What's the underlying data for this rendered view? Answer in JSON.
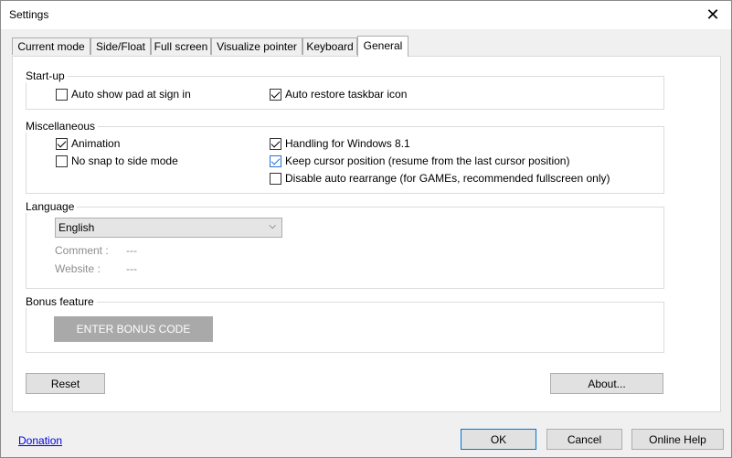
{
  "window": {
    "title": "Settings"
  },
  "tabs": [
    {
      "label": "Current mode"
    },
    {
      "label": "Side/Float"
    },
    {
      "label": "Full screen"
    },
    {
      "label": "Visualize pointer"
    },
    {
      "label": "Keyboard"
    },
    {
      "label": "General",
      "active": true
    }
  ],
  "startup": {
    "legend": "Start-up",
    "auto_show_pad": {
      "label": "Auto show pad at sign in",
      "checked": false
    },
    "auto_restore_taskbar": {
      "label": "Auto restore taskbar icon",
      "checked": true
    }
  },
  "misc": {
    "legend": "Miscellaneous",
    "animation": {
      "label": "Animation",
      "checked": true
    },
    "no_snap": {
      "label": "No snap to side mode",
      "checked": false
    },
    "handling_win81": {
      "label": "Handling for Windows 8.1",
      "checked": true
    },
    "keep_cursor": {
      "label": "Keep cursor position (resume from the last cursor position)",
      "checked": true
    },
    "disable_rearrange": {
      "label": "Disable auto rearrange (for GAMEs, recommended fullscreen only)",
      "checked": false
    }
  },
  "language": {
    "legend": "Language",
    "selected": "English",
    "comment_label": "Comment :",
    "comment_value": "---",
    "website_label": "Website :",
    "website_value": "---"
  },
  "bonus": {
    "legend": "Bonus feature",
    "button_label": "ENTER BONUS CODE"
  },
  "panel_buttons": {
    "reset": "Reset",
    "about": "About..."
  },
  "footer": {
    "donation": "Donation",
    "ok": "OK",
    "cancel": "Cancel",
    "help": "Online Help"
  },
  "icons": {
    "close": "close-icon",
    "dropdown": "chevron-down-icon"
  }
}
